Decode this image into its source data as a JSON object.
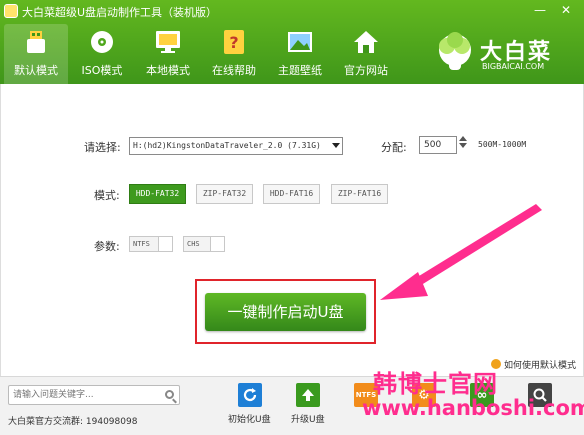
{
  "window": {
    "title": "大白菜超级U盘启动制作工具（装机版）",
    "minimize": "—",
    "close": "✕"
  },
  "tabs": [
    {
      "label": "默认模式",
      "icon": "usb-drive-icon",
      "active": true
    },
    {
      "label": "ISO模式",
      "icon": "disc-icon",
      "active": false
    },
    {
      "label": "本地模式",
      "icon": "monitor-icon",
      "active": false
    },
    {
      "label": "在线帮助",
      "icon": "help-book-icon",
      "active": false
    },
    {
      "label": "主题壁纸",
      "icon": "picture-icon",
      "active": false
    },
    {
      "label": "官方网站",
      "icon": "home-icon",
      "active": false
    }
  ],
  "logo": {
    "name": "大白菜",
    "domain": "BIGBAICAI.COM"
  },
  "form": {
    "select_label": "请选择:",
    "device": "H:(hd2)KingstonDataTraveler_2.0 (7.31G)",
    "alloc_label": "分配:",
    "alloc_value": "500",
    "alloc_range": "500M-1000M",
    "mode_label": "模式:",
    "modes": [
      {
        "label": "HDD-FAT32",
        "active": true
      },
      {
        "label": "ZIP-FAT32",
        "active": false
      },
      {
        "label": "HDD-FAT16",
        "active": false
      },
      {
        "label": "ZIP-FAT16",
        "active": false
      }
    ],
    "param_label": "参数:",
    "params": [
      "NTFS",
      "CHS"
    ]
  },
  "main_button": "一键制作启动U盘",
  "default_link": "如何使用默认模式",
  "watermark": {
    "text": "韩博士官网",
    "url": "www.hanboshi.com"
  },
  "bottom": {
    "search_placeholder": "请输入问题关键字...",
    "qq_group": "大白菜官方交流群: 194098098",
    "tools": [
      {
        "label": "初始化U盘",
        "icon": "refresh-icon",
        "color": "#1e7fd6"
      },
      {
        "label": "升级U盘",
        "icon": "upgrade-arrow-icon",
        "color": "#3a9a1e"
      },
      {
        "label": "",
        "icon": "ntfs-icon",
        "color": "#f28c1b"
      },
      {
        "label": "",
        "icon": "gear-icon",
        "color": "#f28c1b"
      },
      {
        "label": "",
        "icon": "link-icon",
        "color": "#3a9a1e"
      },
      {
        "label": "",
        "icon": "search-icon",
        "color": "#444444"
      }
    ]
  },
  "colors": {
    "header_green": "#4fa71d",
    "button_green": "#3e9a1e",
    "highlight_red": "#e0242b",
    "arrow_magenta": "#ff2d8e"
  }
}
